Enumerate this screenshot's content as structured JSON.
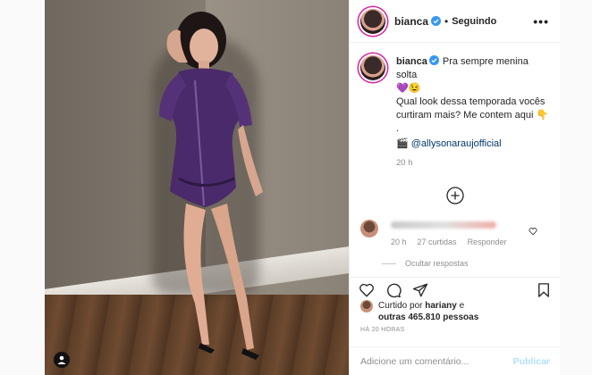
{
  "post": {
    "username": "bianca",
    "follow_dot": "•",
    "follow_status": "Seguindo",
    "more_label": "•••"
  },
  "caption": {
    "username": "bianca",
    "line1": "Pra sempre menina solta",
    "emoji1": "💜😉",
    "line2": "Qual look dessa temporada vocês curtiram mais? Me contem aqui 👇",
    "line3": ".",
    "credit_icon": "🎬",
    "credit_mention": "@allysonaraujofficial",
    "time": "20 h"
  },
  "comment": {
    "time": "20 h",
    "likes": "27 curtidas",
    "reply": "Responder",
    "hide_replies": "Ocultar respostas"
  },
  "likes": {
    "prefix": "Curtido por",
    "user": "hariany",
    "conj": "e",
    "others": "outras 465.810 pessoas"
  },
  "timestamp": "HÁ 20 HORAS",
  "add_comment": {
    "placeholder": "Adicione um comentário...",
    "publish": "Publicar"
  },
  "icons": {
    "verified": "verified-badge-icon",
    "heart": "heart-icon",
    "comment": "comment-icon",
    "share": "share-icon",
    "save": "bookmark-icon",
    "plus": "plus-circle-icon",
    "profile": "profile-icon"
  },
  "colors": {
    "verified": "#3897f0",
    "link": "#00376b",
    "muted": "#8e8e8e",
    "dress": "#4a2a6a"
  }
}
